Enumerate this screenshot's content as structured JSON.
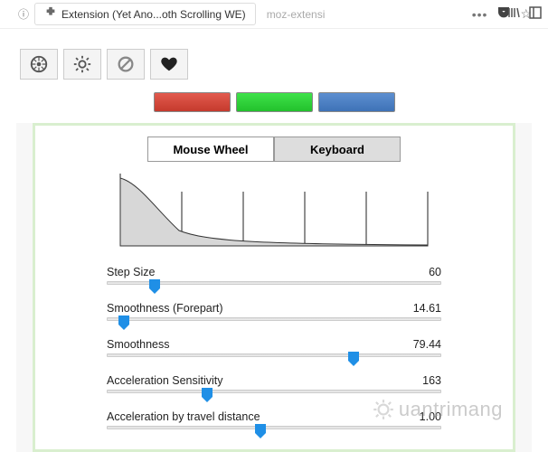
{
  "browser": {
    "tab_title": "Extension (Yet Ano...oth Scrolling WE)",
    "location_field": "moz-extensi"
  },
  "toolbar": {
    "buttons": [
      {
        "name": "wheel-icon"
      },
      {
        "name": "gear-icon"
      },
      {
        "name": "block-icon"
      },
      {
        "name": "heart-icon"
      }
    ],
    "colors": {
      "red": "#d04236",
      "green": "#2dd337",
      "blue": "#4a80c4"
    }
  },
  "panel": {
    "tabs": [
      {
        "label": "Mouse Wheel",
        "active": false
      },
      {
        "label": "Keyboard",
        "active": true
      }
    ],
    "sliders": [
      {
        "label": "Step Size",
        "value": "60",
        "pos": 14
      },
      {
        "label": "Smoothness (Forepart)",
        "value": "14.61",
        "pos": 5
      },
      {
        "label": "Smoothness",
        "value": "79.44",
        "pos": 74
      },
      {
        "label": "Acceleration Sensitivity",
        "value": "163",
        "pos": 30
      },
      {
        "label": "Acceleration by travel distance",
        "value": "1.00",
        "pos": 46
      }
    ]
  },
  "chart_data": {
    "type": "line",
    "title": "",
    "xlabel": "",
    "ylabel": "",
    "x": [
      0,
      10,
      20,
      30,
      40,
      50,
      60,
      70,
      80,
      90,
      100
    ],
    "values": [
      90,
      55,
      30,
      16,
      9,
      5,
      3,
      2,
      1,
      1,
      1
    ],
    "ylim": [
      0,
      100
    ],
    "ticks_x": [
      0,
      20,
      40,
      60,
      80,
      100
    ]
  },
  "watermark": "uantrimang"
}
